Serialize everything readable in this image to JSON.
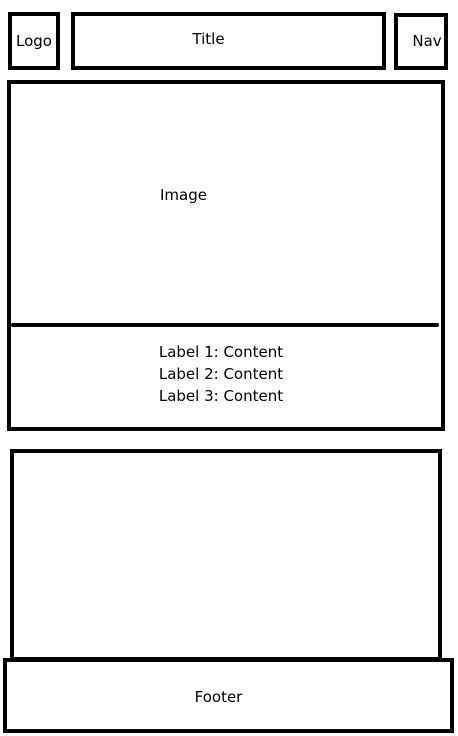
{
  "header": {
    "logo": "Logo",
    "title": "Title",
    "nav": "Nav"
  },
  "card": {
    "image_label": "Image",
    "labels": [
      "Label 1: Content",
      "Label 2: Content",
      "Label 3: Content"
    ]
  },
  "footer": {
    "text": "Footer"
  }
}
